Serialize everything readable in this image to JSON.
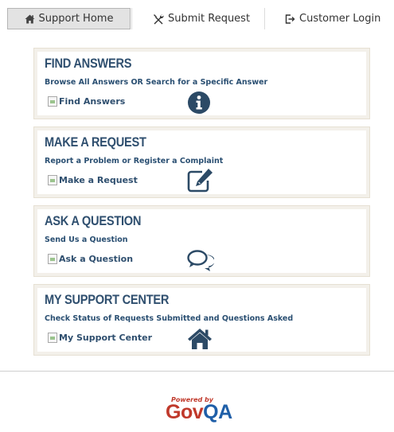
{
  "nav": {
    "support_home": "Support Home",
    "submit_request": "Submit Request",
    "customer_login": "Customer Login",
    "icons": {
      "support_home": "home-icon",
      "submit_request": "tools-icon",
      "customer_login": "login-icon"
    }
  },
  "cards": [
    {
      "title": "FIND ANSWERS",
      "subtitle": "Browse All Answers OR Search for a Specific Answer",
      "link": "Find Answers",
      "icon": "info-icon"
    },
    {
      "title": "MAKE A REQUEST",
      "subtitle": "Report a Problem or Register a Complaint",
      "link": "Make a Request",
      "icon": "edit-icon"
    },
    {
      "title": "ASK A QUESTION",
      "subtitle": "Send Us a Question",
      "link": "Ask a Question",
      "icon": "chat-icon"
    },
    {
      "title": "MY SUPPORT CENTER",
      "subtitle": "Check Status of Requests Submitted and Questions Asked",
      "link": "My Support Center",
      "icon": "home-icon"
    }
  ],
  "footer": {
    "powered_by": "Powered by",
    "brand_gov": "Gov",
    "brand_qa": "QA"
  },
  "colors": {
    "title": "#2f4f6f",
    "icon": "#2c4a66",
    "brand_red": "#c0392b",
    "brand_blue": "#1f5fa8"
  }
}
